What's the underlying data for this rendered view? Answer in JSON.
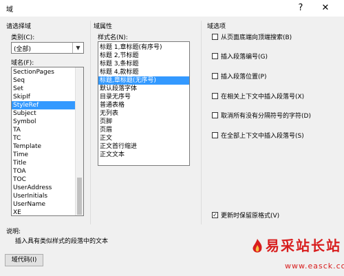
{
  "window": {
    "title": "域",
    "help_icon": "?",
    "close_icon": "✕"
  },
  "select_field": {
    "header": "请选择域",
    "category_label": "类别(C):",
    "category_value": "(全部)",
    "fieldnames_label": "域名(F):",
    "fieldnames": [
      "SectionPages",
      "Seq",
      "Set",
      "SkipIf",
      "StyleRef",
      "Subject",
      "Symbol",
      "TA",
      "TC",
      "Template",
      "Time",
      "Title",
      "TOA",
      "TOC",
      "UserAddress",
      "UserInitials",
      "UserName",
      "XE"
    ],
    "selected_fieldname": "StyleRef"
  },
  "field_properties": {
    "header": "域属性",
    "stylename_label": "样式名(N):",
    "stylenames": [
      "标题 1,章标题(有序号)",
      "标题 2,节标题",
      "标题 3,条标题",
      "标题 4,款标题",
      "标题,章标题(无序号)",
      "默认段落字体",
      "目录无序号",
      "普通表格",
      "无列表",
      "页脚",
      "页眉",
      "正文",
      "正文首行缩进",
      "正文文本"
    ],
    "selected_stylename": "标题,章标题(无序号)"
  },
  "field_options": {
    "header": "域选项",
    "options": [
      {
        "label": "从页面底端向顶端搜索(B)",
        "checked": false
      },
      {
        "label": "插入段落编号(G)",
        "checked": false
      },
      {
        "label": "插入段落位置(P)",
        "checked": false
      },
      {
        "label": "在相关上下文中插入段落号(X)",
        "checked": false
      },
      {
        "label": "取消所有没有分隔符号的字符(D)",
        "checked": false
      },
      {
        "label": "在全部上下文中插入段落号(S)",
        "checked": false
      }
    ],
    "preserve_format": {
      "label": "更新时保留原格式(V)",
      "checked": true
    }
  },
  "description": {
    "label": "说明:",
    "text": "插入具有类似样式的段落中的文本"
  },
  "buttons": {
    "field_codes": "域代码(I)"
  },
  "watermark": {
    "line1": "易采站长站",
    "line2": "www.easck.com"
  }
}
